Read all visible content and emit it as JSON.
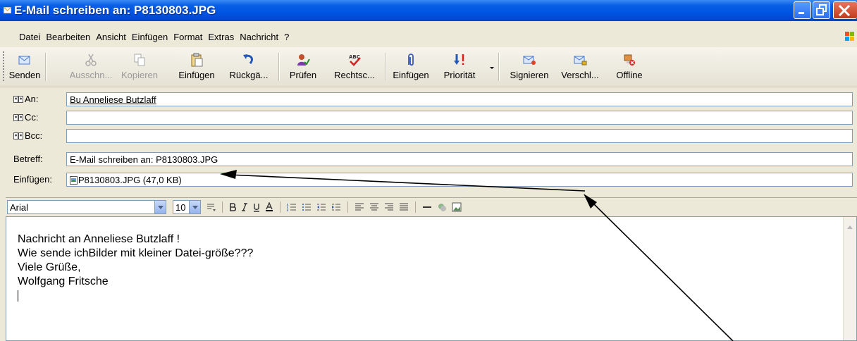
{
  "window": {
    "title": "E-Mail schreiben an: P8130803.JPG"
  },
  "menu": [
    "Datei",
    "Bearbeiten",
    "Ansicht",
    "Einfügen",
    "Format",
    "Extras",
    "Nachricht",
    "?"
  ],
  "toolbar": [
    {
      "label": "Senden",
      "icon": "send-icon",
      "disabled": false
    },
    {
      "label": "Ausschn...",
      "icon": "cut-icon",
      "disabled": true
    },
    {
      "label": "Kopieren",
      "icon": "copy-icon",
      "disabled": true
    },
    {
      "label": "Einfügen",
      "icon": "paste-icon",
      "disabled": false
    },
    {
      "label": "Rückgä...",
      "icon": "undo-icon",
      "disabled": false
    },
    {
      "label": "Prüfen",
      "icon": "check-names-icon",
      "disabled": false
    },
    {
      "label": "Rechtsc...",
      "icon": "spelling-icon",
      "disabled": false
    },
    {
      "label": "Einfügen",
      "icon": "attach-icon",
      "disabled": false
    },
    {
      "label": "Priorität",
      "icon": "priority-icon",
      "disabled": false
    },
    {
      "label": "Signieren",
      "icon": "sign-icon",
      "disabled": false
    },
    {
      "label": "Verschl...",
      "icon": "encrypt-icon",
      "disabled": false
    },
    {
      "label": "Offline",
      "icon": "offline-icon",
      "disabled": false
    }
  ],
  "header": {
    "to_label": "An:",
    "to_value": "Bu Anneliese Butzlaff",
    "cc_label": "Cc:",
    "cc_value": "",
    "bcc_label": "Bcc:",
    "bcc_value": "",
    "subject_label": "Betreff:",
    "subject_value": "E-Mail schreiben an: P8130803.JPG",
    "attach_label": "Einfügen:",
    "attach_value": "P8130803.JPG (47,0 KB)"
  },
  "format": {
    "font": "Arial",
    "size": "10"
  },
  "body": {
    "lines": [
      "Nachricht an Anneliese Butzlaff !",
      "Wie sende ichBilder mit kleiner Datei-größe???",
      "Viele Grüße,",
      "Wolfgang Fritsche"
    ]
  },
  "colors": {
    "titlebar": "#0054e3",
    "chrome": "#ece9d8",
    "field_border": "#7f9db9"
  }
}
